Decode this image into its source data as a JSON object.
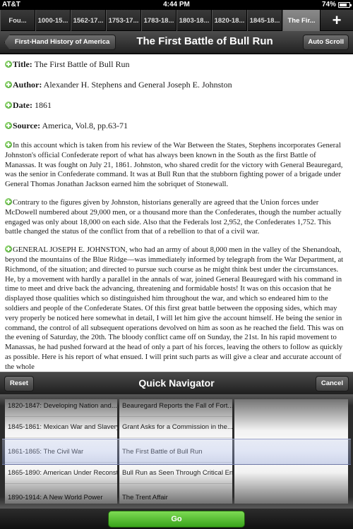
{
  "status": {
    "carrier": "AT&T",
    "time": "4:44 PM",
    "battery_pct": "74%",
    "battery_level": 0.74
  },
  "tabs": [
    "Fou...",
    "1000-15...",
    "1562-17...",
    "1753-17...",
    "1783-18...",
    "1803-18...",
    "1820-18...",
    "1845-18...",
    "The Fir..."
  ],
  "tab_add": "+",
  "nav": {
    "back_label": "First-Hand History of America",
    "title": "The First Battle of Bull Run",
    "auto_scroll": "Auto Scroll"
  },
  "doc": {
    "title_label": "Title:",
    "title_value": " The First Battle of Bull Run",
    "author_label": "Author:",
    "author_value": " Alexander H. Stephens and General Joseph E. Johnston",
    "date_label": "Date:",
    "date_value": " 1861",
    "source_label": "Source:",
    "source_value": " America, Vol.8, pp.63-71",
    "p1": "In this account which is taken from his review of the War Between the States, Stephens incorporates General Johnston's official Confederate report of what has always been known in the South as the first Battle of Manassas. It was fought on July 21, 1861. Johnston, who shared credit for the victory with General Beauregard, was the senior in Confederate command. It was at Bull Run that the stubborn fighting power of a brigade under General Thomas Jonathan Jackson earned him the sobriquet of Stonewall.",
    "p2": "Contrary to the figures given by Johnston, historians generally are agreed that the Union forces under McDowell numbered about 29,000 men, or a thousand more than the Confederates, though the number actually engaged was only about 18,000 on each side. Also that the Federals lost 2,952, the Confederates 1,752. This battle changed the status of the conflict from that of a rebellion to that of a civil war.",
    "p3": "GENERAL JOSEPH E. JOHNSTON, who had an army of about 8,000 men in the valley of the Shenandoah, beyond the mountains of the Blue Ridge—was immediately informed by telegraph from the War Department, at Richmond, of the situation; and directed to pursue such course as he might think best under the circumstances. He, by a movement with hardly a parallel in the annals of war, joined General Beauregard with his command in time to meet and drive back the advancing, threatening and formidable hosts! It was on this occasion that he displayed those qualities which so distinguished him throughout the war, and which so endeared him to the soldiers and people of the Confederate States. Of this first great battle between the opposing sides, which may very properly be noticed here somewhat in detail, I will let him give the account himself. He being the senior in command, the control of all subsequent operations devolved on him as soon as he reached the field. This was on the evening of Saturday, the 20th. The bloody conflict came off on Sunday, the 21st. In his rapid movement to Manassas, he had pushed forward at the head of only a part of his forces, leaving the others to follow as quickly as possible. Here is his report of what ensued. I will print such parts as will give a clear and accurate account of the whole"
  },
  "navigator": {
    "reset": "Reset",
    "title": "Quick Navigator",
    "cancel": "Cancel",
    "col1": [
      "1820-1847: Developing Nation and...",
      "1845-1861: Mexican War and Slavery",
      "1861-1865: The Civil War",
      "1865-1890: American Under Reconst...",
      "1890-1914: A New World Power"
    ],
    "col2": [
      "Beauregard Reports the Fall of Fort...",
      "Grant Asks for a Commission in the...",
      "The First Battle of Bull Run",
      "Bull Run as Seen Through Critical En...",
      "The Trent Affair"
    ],
    "go": "Go"
  }
}
